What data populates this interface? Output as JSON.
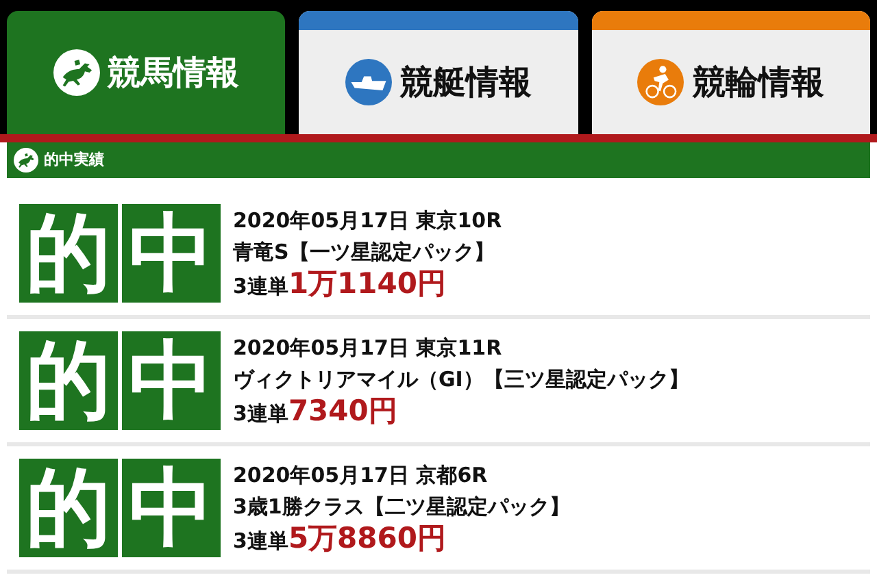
{
  "tabs": [
    {
      "label": "競馬情報",
      "selected": true,
      "color": "#1e7420",
      "kind": "horse"
    },
    {
      "label": "競艇情報",
      "selected": false,
      "color": "#2e76c0",
      "kind": "boat"
    },
    {
      "label": "競輪情報",
      "selected": false,
      "color": "#e97c0b",
      "kind": "bike"
    }
  ],
  "section_header": {
    "title": "的中実績"
  },
  "hits": [
    {
      "badge": [
        "的",
        "中"
      ],
      "race": "2020年05月17日 東京10R",
      "title": "青竜S【一ツ星認定パック】",
      "bet": "3連単",
      "payout": "1万1140円"
    },
    {
      "badge": [
        "的",
        "中"
      ],
      "race": "2020年05月17日 東京11R",
      "title": "ヴィクトリアマイル（GI）【三ツ星認定パック】",
      "bet": "3連単",
      "payout": "7340円"
    },
    {
      "badge": [
        "的",
        "中"
      ],
      "race": "2020年05月17日 京都6R",
      "title": "3歳1勝クラス【二ツ星認定パック】",
      "bet": "3連単",
      "payout": "5万8860円"
    }
  ]
}
